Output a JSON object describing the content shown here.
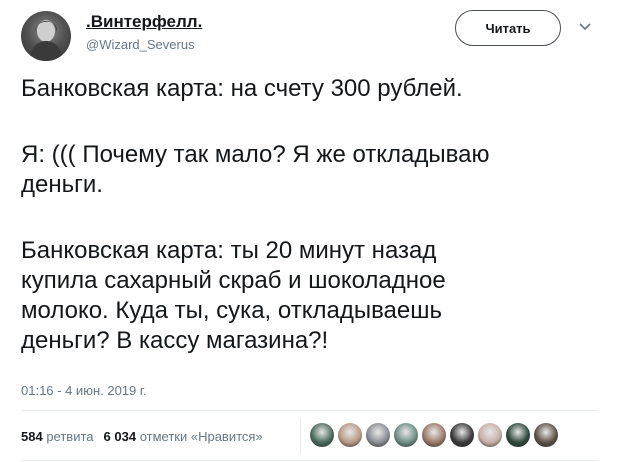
{
  "author": {
    "display_name": ".Винтерфелл.",
    "handle": "@Wizard_Severus",
    "avatar_icon": "avatar-photo"
  },
  "follow_label": "Читать",
  "menu_icon": "chevron-down-icon",
  "tweet_lines": [
    "Банковская карта: на счету 300 рублей.",
    "Я: ((( Почему так мало? Я же откладываю",
    "деньги.",
    "Банковская карта: ты 20 минут назад",
    "купила сахарный скраб и шоколадное",
    "молоко. Куда ты, сука, откладываешь",
    "деньги? В кассу магазина?!"
  ],
  "timestamp": "01:16 - 4 июн. 2019 г.",
  "stats": {
    "retweets_count": "584",
    "retweets_label": "ретвита",
    "likes_count": "6 034",
    "likes_label": "отметки «Нравится»"
  },
  "likers": [
    {
      "icon": "liker-avatar",
      "color": "#4a6b5d"
    },
    {
      "icon": "liker-avatar",
      "color": "#b89a86"
    },
    {
      "icon": "liker-avatar",
      "color": "#8a8f96"
    },
    {
      "icon": "liker-avatar",
      "color": "#6f8f86"
    },
    {
      "icon": "liker-avatar",
      "color": "#9a7a6a"
    },
    {
      "icon": "liker-avatar",
      "color": "#3a3a3a"
    },
    {
      "icon": "liker-avatar",
      "color": "#c9b0a8"
    },
    {
      "icon": "liker-avatar",
      "color": "#2e4a3c"
    },
    {
      "icon": "liker-avatar",
      "color": "#5d5248"
    }
  ],
  "colors": {
    "text": "#14171a",
    "muted": "#657786",
    "divider": "#e6ecf0"
  }
}
